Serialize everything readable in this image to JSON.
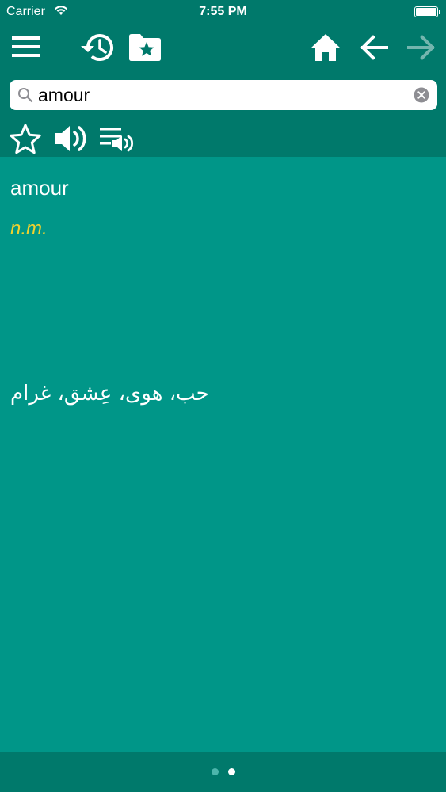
{
  "status": {
    "carrier": "Carrier",
    "time": "7:55 PM"
  },
  "toolbar": {
    "icons": [
      "menu-icon",
      "history-icon",
      "favorites-folder-icon",
      "home-icon",
      "back-arrow-icon",
      "forward-arrow-icon"
    ],
    "forward_enabled": false
  },
  "search": {
    "value": "amour",
    "placeholder": ""
  },
  "actions": {
    "icons": [
      "star-icon",
      "speaker-icon",
      "playlist-audio-icon"
    ]
  },
  "entry": {
    "headword": "amour",
    "part_of_speech": "n.m.",
    "translation": "حب، هوى، عِشق، غرام"
  },
  "pager": {
    "page_count": 2,
    "current_page": 2
  },
  "colors": {
    "toolbar": "#00796b",
    "content": "#009688",
    "pos_text": "#f2d22e"
  }
}
